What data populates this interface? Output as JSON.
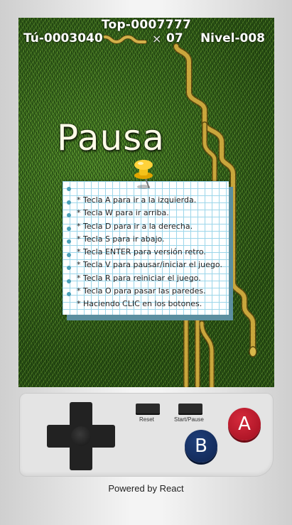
{
  "hud": {
    "top_score": "Top-0007777",
    "your_score": "Tú-0003040",
    "multiplier": "×",
    "count": "07",
    "level": "Nivel-008"
  },
  "pause": {
    "title": "Pausa",
    "instructions": [
      "* Tecla A para ir a la izquierda.",
      "* Tecla W para ir arriba.",
      "* Tecla D para ir a la derecha.",
      "* Tecla S para ir abajo.",
      "* Tecla ENTER para versión retro.",
      "* Tecla V para pausar/iniciar el juego.",
      "* Tecla R para reiniciar el juego.",
      "* Tecla O para pasar las paredes.",
      "* Haciendo CLIC en los botones."
    ]
  },
  "controls": {
    "reset_label": "Reset",
    "start_pause_label": "Start/Pause",
    "a_label": "A",
    "b_label": "B"
  },
  "footer": {
    "text": "Powered by React"
  },
  "colors": {
    "snake": "#c9a63c",
    "grass": "#3c6a1f",
    "button_a": "#c21d30",
    "button_b": "#14306a",
    "note_grid": "#9cd6ea"
  },
  "icons": [
    "snake-icon",
    "pushpin-icon",
    "dpad-icon"
  ]
}
